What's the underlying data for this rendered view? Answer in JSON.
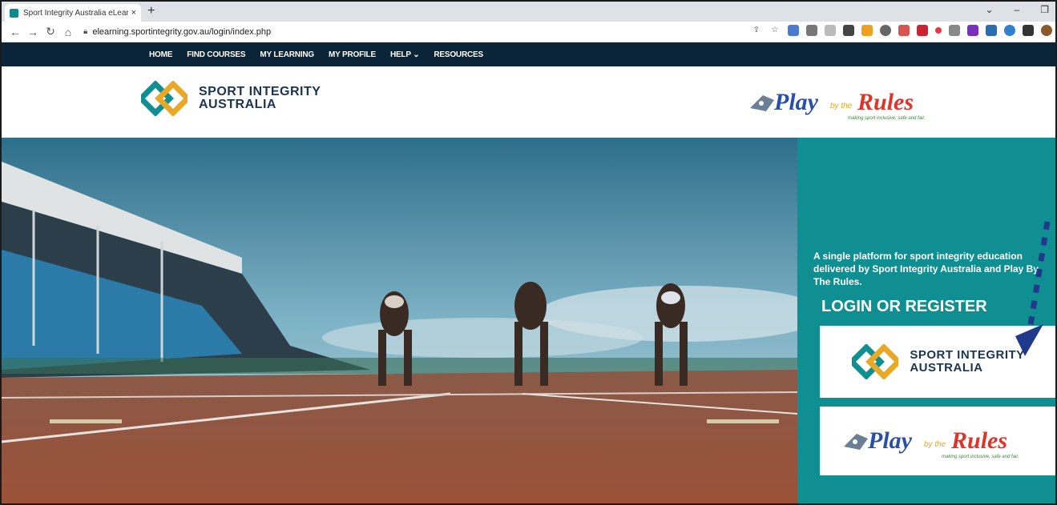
{
  "browser": {
    "tab_title": "Sport Integrity Australia eLearnin",
    "tab_close": "×",
    "new_tab": "+",
    "url": "elearning.sportintegrity.gov.au/login/index.php"
  },
  "nav": {
    "items": [
      "HOME",
      "FIND COURSES",
      "MY LEARNING",
      "MY PROFILE",
      "HELP ⌄",
      "RESOURCES"
    ]
  },
  "header": {
    "sia_line1": "SPORT INTEGRITY",
    "sia_line2": "AUSTRALIA",
    "pbtr_play": "Play",
    "pbtr_by": "by the",
    "pbtr_rules": "Rules",
    "pbtr_tagline": "making sport inclusive, safe and fair."
  },
  "side": {
    "intro": "A single platform for sport integrity education delivered by Sport Integrity Australia and Play By The Rules.",
    "login_heading": "LOGIN OR REGISTER"
  },
  "colors": {
    "nav_bg": "#0c2437",
    "teal": "#0f8f92",
    "sia_blue": "#1b3550",
    "sia_gold": "#e9a825",
    "pbtr_blue": "#2a4fa8",
    "pbtr_red": "#e0342a"
  }
}
